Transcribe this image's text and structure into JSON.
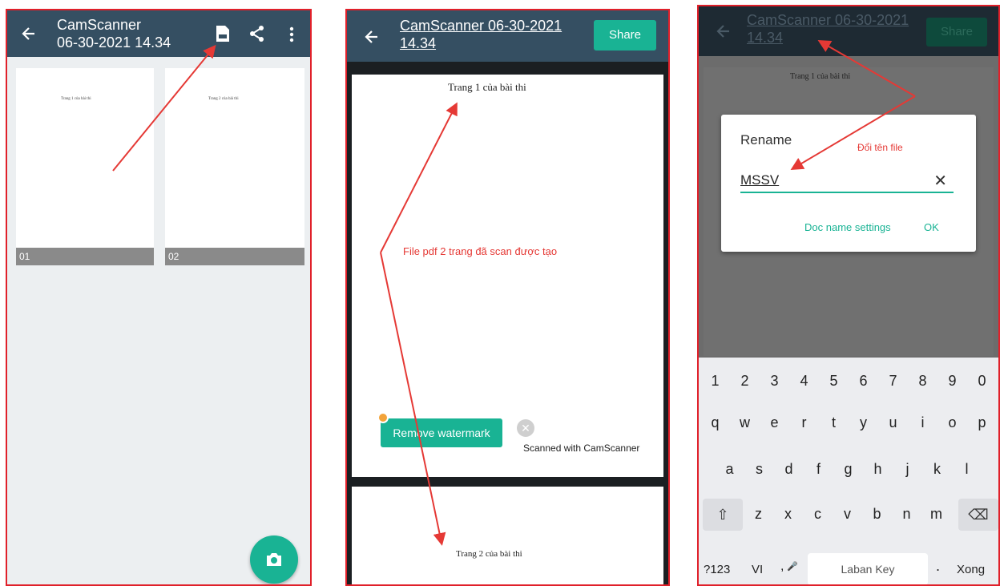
{
  "panel1": {
    "title_line1": "CamScanner",
    "title_line2": "06-30-2021 14.34",
    "thumbs": [
      {
        "label": "01",
        "text": "Trang 1 của bài thi"
      },
      {
        "label": "02",
        "text": "Trang 2 của bài thi"
      }
    ]
  },
  "panel2": {
    "title": "CamScanner 06-30-2021 14.34",
    "share": "Share",
    "page1_text": "Trang 1 của bài thi",
    "annotation": "File pdf 2 trang đã scan được tạo",
    "remove_watermark": "Remove watermark",
    "scanned_with": "Scanned with CamScanner",
    "page2_text": "Trang 2 của bài thi"
  },
  "panel3": {
    "title": "CamScanner 06-30-2021 14.34",
    "share": "Share",
    "page_text": "Trang 1 của bài thi",
    "dialog": {
      "title": "Rename",
      "annotation": "Đổi tên file",
      "value": "MSSV",
      "settings": "Doc name settings",
      "ok": "OK"
    },
    "keyboard": {
      "row1": [
        "1",
        "2",
        "3",
        "4",
        "5",
        "6",
        "7",
        "8",
        "9",
        "0"
      ],
      "row2": [
        "q",
        "w",
        "e",
        "r",
        "t",
        "y",
        "u",
        "i",
        "o",
        "p"
      ],
      "row3": [
        "a",
        "s",
        "d",
        "f",
        "g",
        "h",
        "j",
        "k",
        "l"
      ],
      "row4": [
        "z",
        "x",
        "c",
        "v",
        "b",
        "n",
        "m"
      ],
      "num": "?123",
      "lang": "VI",
      "comma": ",",
      "space": "Laban Key",
      "period": ".",
      "enter": "Xong"
    }
  },
  "colors": {
    "header": "#354f62",
    "teal": "#19b394",
    "annotation": "#e53935"
  }
}
